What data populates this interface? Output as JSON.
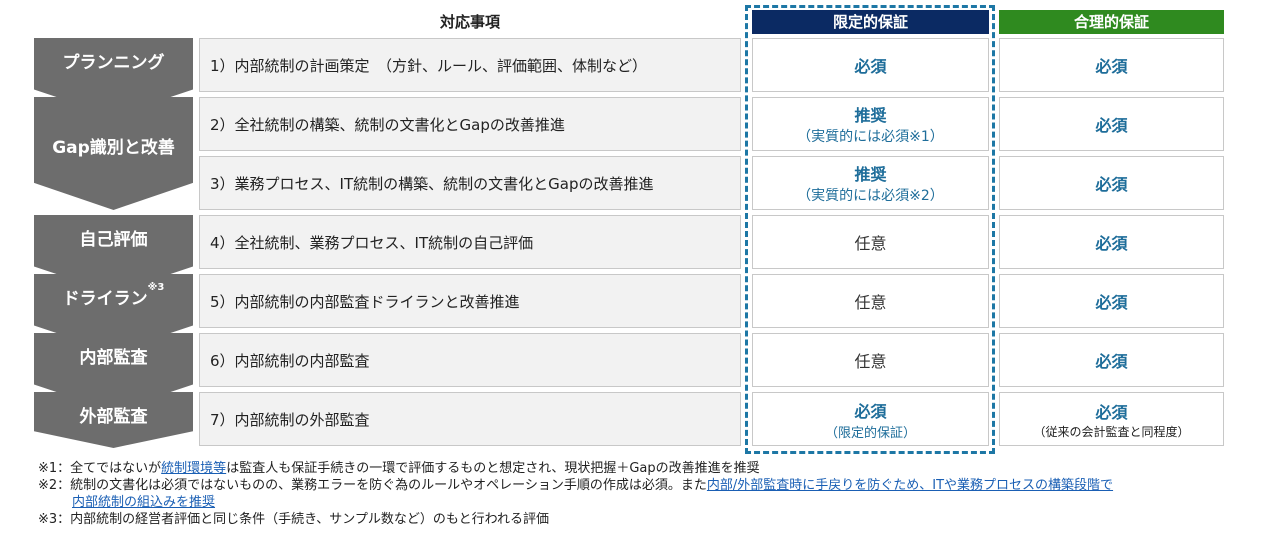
{
  "header": {
    "task": "対応事項",
    "limited": "限定的保証",
    "reasonable": "合理的保証"
  },
  "colors": {
    "limited_header": "#0b2a63",
    "reasonable_header": "#2f8a1f",
    "phase": "#6d6d6d",
    "dashed": "#1d77a5",
    "accent_text": "#1e6d9a"
  },
  "phases": [
    {
      "label": "プランニング",
      "sup": ""
    },
    {
      "label": "Gap識別と改善",
      "sup": ""
    },
    {
      "label": "自己評価",
      "sup": ""
    },
    {
      "label": "ドライラン",
      "sup": "※3"
    },
    {
      "label": "内部監査",
      "sup": ""
    },
    {
      "label": "外部監査",
      "sup": ""
    }
  ],
  "rows": [
    {
      "task": "1）内部統制の計画策定　（方針、ルール、評価範囲、体制など）",
      "limited": "必須",
      "limited_sub": "",
      "reasonable": "必須",
      "reasonable_sub": ""
    },
    {
      "task": "2）全社統制の構築、統制の文書化とGapの改善推進",
      "limited": "推奨",
      "limited_sub": "（実質的には必須※1）",
      "reasonable": "必須",
      "reasonable_sub": ""
    },
    {
      "task": "3）業務プロセス、IT統制の構築、統制の文書化とGapの改善推進",
      "limited": "推奨",
      "limited_sub": "（実質的には必須※2）",
      "reasonable": "必須",
      "reasonable_sub": ""
    },
    {
      "task": "4）全社統制、業務プロセス、IT統制の自己評価",
      "limited": "任意",
      "limited_sub": "",
      "reasonable": "必須",
      "reasonable_sub": ""
    },
    {
      "task": "5）内部統制の内部監査ドライランと改善推進",
      "limited": "任意",
      "limited_sub": "",
      "reasonable": "必須",
      "reasonable_sub": ""
    },
    {
      "task": "6）内部統制の内部監査",
      "limited": "任意",
      "limited_sub": "",
      "reasonable": "必須",
      "reasonable_sub": ""
    },
    {
      "task": "7）内部統制の外部監査",
      "limited": "必須",
      "limited_sub": "（限定的保証）",
      "reasonable": "必須",
      "reasonable_sub": "（従来の会計監査と同程度）"
    }
  ],
  "notes": {
    "n1_prefix": "※1：全てではないが",
    "n1_link": "統制環境等",
    "n1_suffix": "は監査人も保証手続きの一環で評価するものと想定され、現状把握＋Gapの改善推進を推奨",
    "n2_prefix": "※2：統制の文書化は必須ではないものの、業務エラーを防ぐ為のルールやオペレーション手順の作成は必須。また",
    "n2_link": "内部/外部監査時に手戻りを防ぐため、ITや業務プロセスの構築段階で",
    "n2_link2": "内部統制の組込みを推奨",
    "n3": "※3：内部統制の経営者評価と同じ条件（手続き、サンプル数など）のもと行われる評価"
  }
}
